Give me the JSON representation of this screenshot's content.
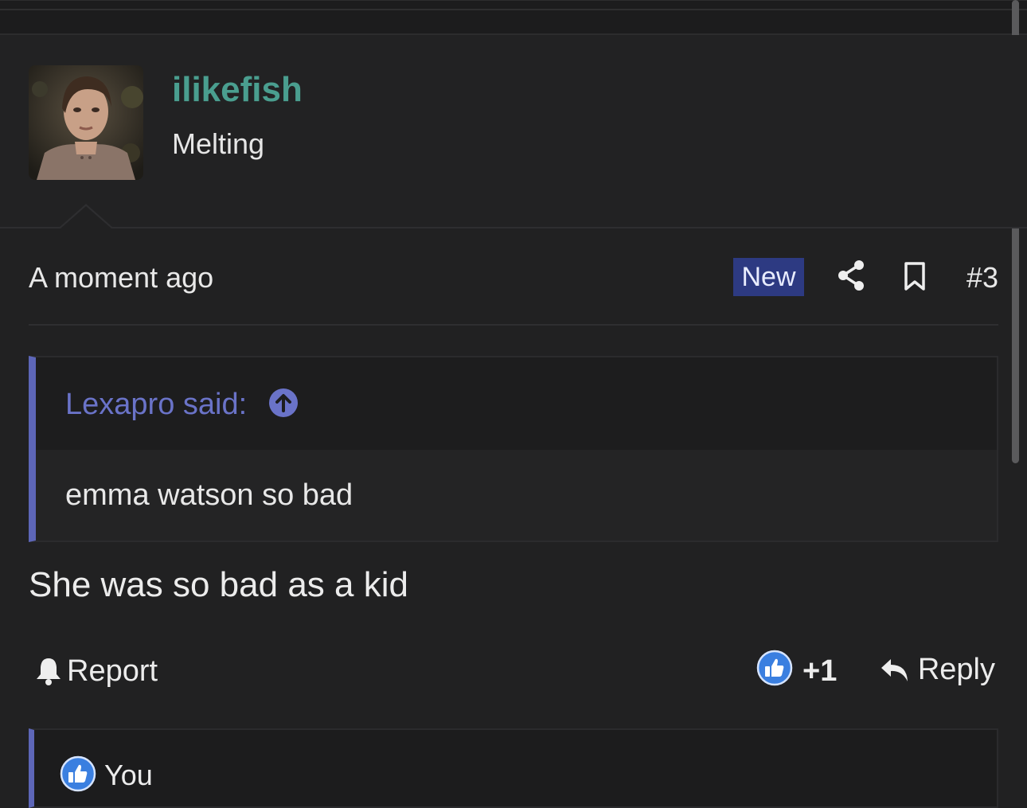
{
  "post": {
    "author": "ilikefish",
    "user_title": "Melting",
    "timestamp": "A moment ago",
    "badge": "New",
    "number": "#3",
    "message": "She was so bad as a kid"
  },
  "quote": {
    "author_label": "Lexapro said:",
    "text": "emma watson so bad"
  },
  "actions": {
    "report_label": "Report",
    "reaction_count": "+1",
    "reply_label": "Reply"
  },
  "reactions": {
    "user": "You"
  },
  "icons": {
    "share": "share-icon",
    "bookmark": "bookmark-icon",
    "quote_jump": "arrow-up-circle-icon",
    "report": "bell-icon",
    "like": "thumbs-up-icon",
    "reply": "reply-arrow-icon"
  },
  "colors": {
    "background": "#212122",
    "username": "#4a9e8f",
    "badge_bg": "#2d3a82",
    "quote_accent": "#5d66b8",
    "quote_author": "#6a73c8",
    "like_blue": "#3a7fe0"
  }
}
